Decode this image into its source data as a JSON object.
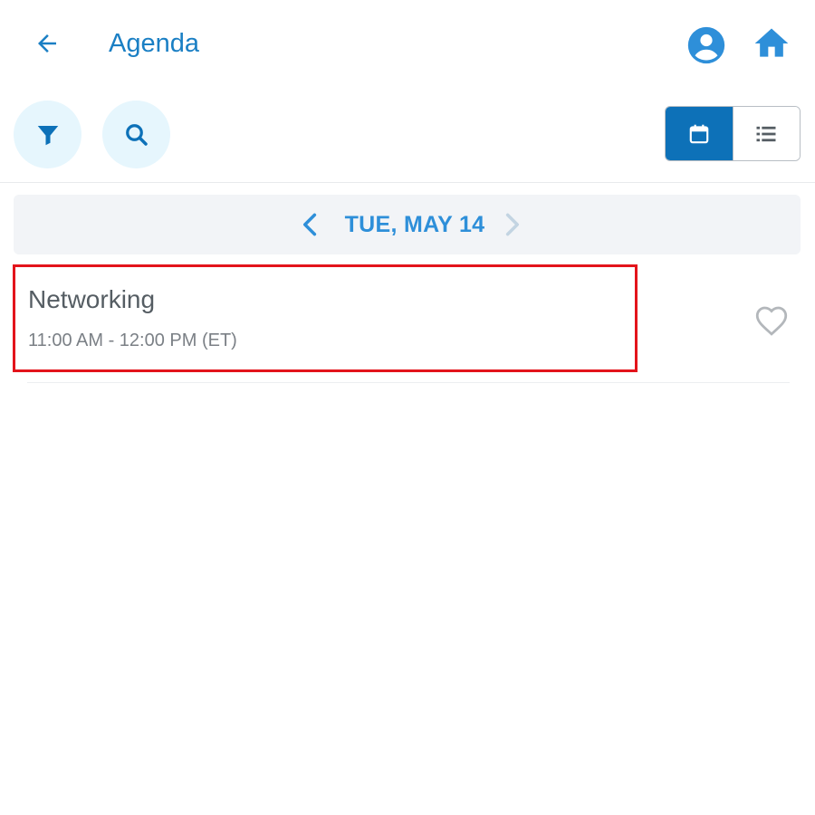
{
  "header": {
    "title": "Agenda",
    "back_icon": "arrow-left-icon",
    "profile_icon": "account-circle-icon",
    "home_icon": "home-icon"
  },
  "toolbar": {
    "filter_icon": "filter-icon",
    "search_icon": "search-icon",
    "view_toggle": {
      "selected": "calendar",
      "options": [
        "calendar",
        "list"
      ]
    }
  },
  "date_nav": {
    "label": "TUE, MAY 14",
    "prev_icon": "chevron-left-icon",
    "next_icon": "chevron-right-icon"
  },
  "sessions": [
    {
      "title": "Networking",
      "time": "11:00 AM - 12:00 PM (ET)",
      "favorite": false
    }
  ],
  "colors": {
    "primary": "#1a7fc4",
    "accent_blue": "#2e8fd9",
    "toggle_active": "#0d71b8",
    "circle_bg": "#e6f6fd",
    "date_bar_bg": "#f2f4f7",
    "highlight_border": "#e3141b"
  }
}
